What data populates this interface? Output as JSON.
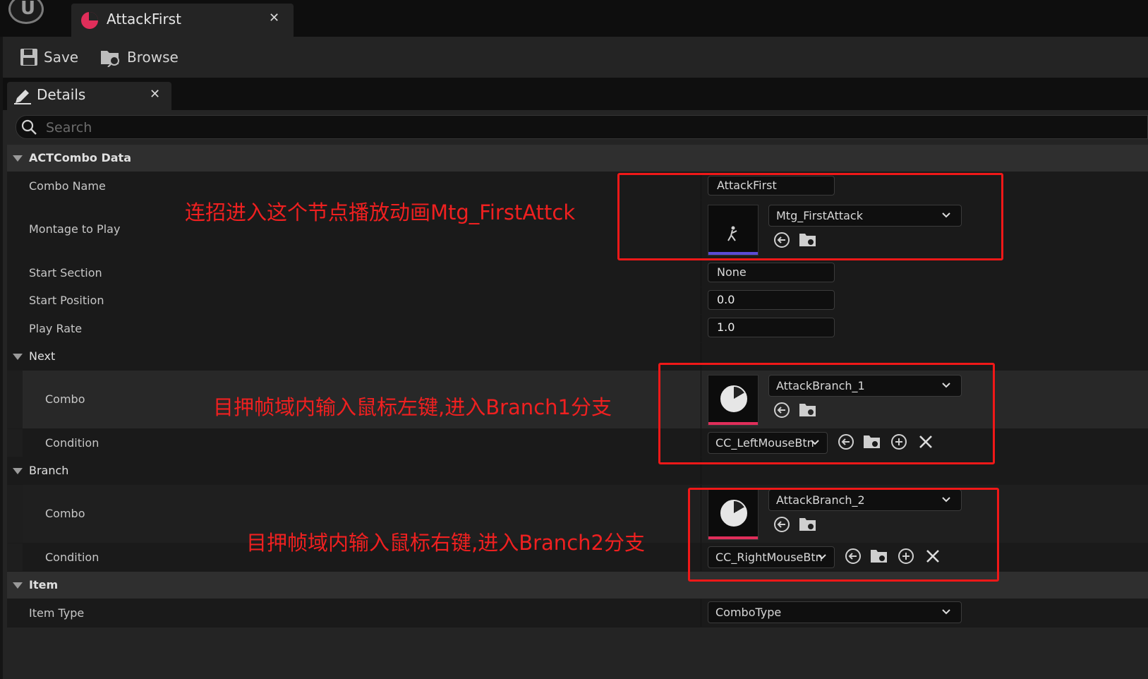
{
  "window": {
    "tab_title": "AttackFirst"
  },
  "toolbar": {
    "save_label": "Save",
    "browse_label": "Browse"
  },
  "details": {
    "tab_title": "Details",
    "search_placeholder": "Search"
  },
  "categories": {
    "actcombo": "ACTCombo Data",
    "next": "Next",
    "branch": "Branch",
    "item": "Item"
  },
  "props": {
    "combo_name": {
      "label": "Combo Name",
      "value": "AttackFirst"
    },
    "montage": {
      "label": "Montage to Play",
      "value": "Mtg_FirstAttack"
    },
    "start_section": {
      "label": "Start Section",
      "value": "None"
    },
    "start_position": {
      "label": "Start Position",
      "value": "0.0"
    },
    "play_rate": {
      "label": "Play Rate",
      "value": "1.0"
    },
    "next_combo": {
      "label": "Combo",
      "value": "AttackBranch_1"
    },
    "next_condition": {
      "label": "Condition",
      "value": "CC_LeftMouseBtn"
    },
    "branch_combo": {
      "label": "Combo",
      "value": "AttackBranch_2"
    },
    "branch_condition": {
      "label": "Condition",
      "value": "CC_RightMouseBtn"
    },
    "item_type": {
      "label": "Item Type",
      "value": "ComboType"
    }
  },
  "annotations": {
    "a1": "连招进入这个节点播放动画Mtg_FirstAttck",
    "a2": "目押帧域内输入鼠标左键,进入Branch1分支",
    "a3": "目押帧域内输入鼠标右键,进入Branch2分支"
  },
  "colors": {
    "annotation": "#f01818",
    "asset_accent": "#e02e5a",
    "montage_accent": "#5b4bd6"
  }
}
